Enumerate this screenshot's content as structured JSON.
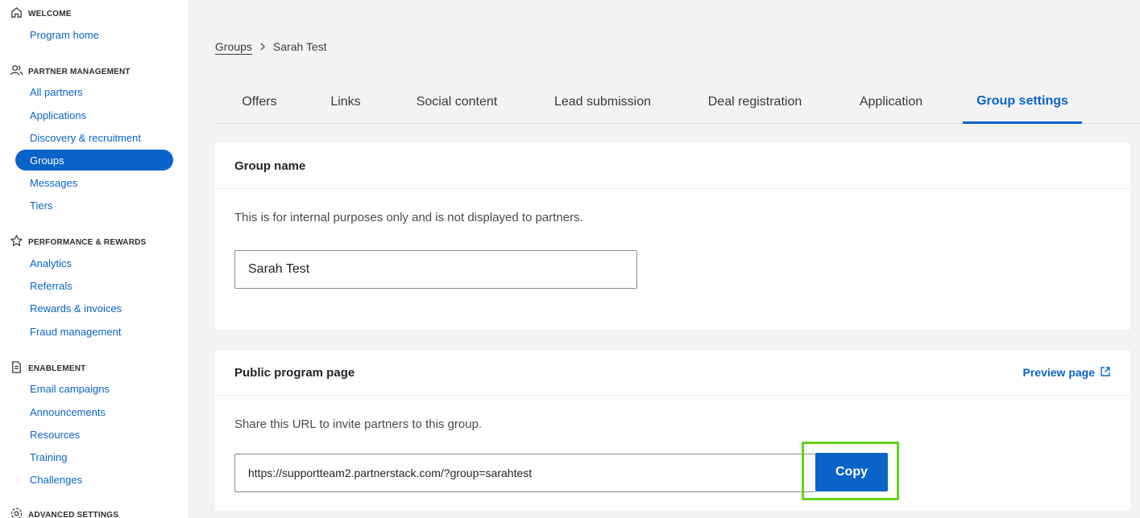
{
  "sidebar": {
    "welcome": {
      "heading": "WELCOME",
      "items": [
        "Program home"
      ]
    },
    "partner_management": {
      "heading": "PARTNER MANAGEMENT",
      "items": [
        "All partners",
        "Applications",
        "Discovery & recruitment",
        "Groups",
        "Messages",
        "Tiers"
      ]
    },
    "performance_rewards": {
      "heading": "PERFORMANCE & REWARDS",
      "items": [
        "Analytics",
        "Referrals",
        "Rewards & invoices",
        "Fraud management"
      ]
    },
    "enablement": {
      "heading": "ENABLEMENT",
      "items": [
        "Email campaigns",
        "Announcements",
        "Resources",
        "Training",
        "Challenges"
      ]
    },
    "advanced_settings": {
      "heading": "ADVANCED SETTINGS"
    },
    "active_item": "Groups"
  },
  "breadcrumb": {
    "parent": "Groups",
    "current": "Sarah Test"
  },
  "tabs": [
    "Offers",
    "Links",
    "Social content",
    "Lead submission",
    "Deal registration",
    "Application",
    "Group settings"
  ],
  "active_tab": "Group settings",
  "group_name_card": {
    "title": "Group name",
    "description": "This is for internal purposes only and is not displayed to partners.",
    "value": "Sarah Test"
  },
  "public_page_card": {
    "title": "Public program page",
    "preview_label": "Preview page",
    "description": "Share this URL to invite partners to this group.",
    "url": "https://supportteam2.partnerstack.com/?group=sarahtest",
    "copy_label": "Copy"
  },
  "colors": {
    "accent": "#0a63c9",
    "highlight": "#62d41b"
  }
}
